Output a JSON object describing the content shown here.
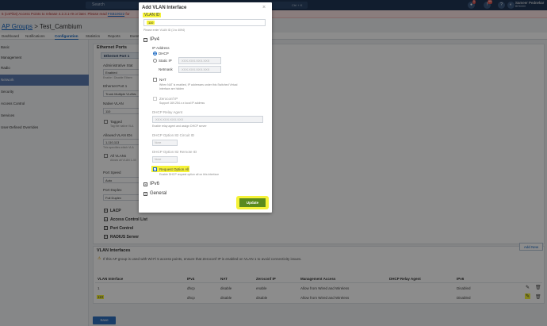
{
  "topbar": {
    "search_placeholder": "Search",
    "shortcut": "Ctrl + K",
    "notif_badge": "1",
    "alert_badge": "99",
    "user_name": "Sameer Pednekar",
    "user_role": "BRK000"
  },
  "banner": {
    "text": "5 (cnPilot) Access Points to release 4.2.3.1-r9 or later. Please read",
    "link": "FSB19022",
    "suffix": "for"
  },
  "breadcrumb": {
    "root": "AP Groups",
    "sep": ">",
    "current": "Test_Cambium"
  },
  "tabs": [
    "Dashboard",
    "Notifications",
    "Configuration",
    "Statistics",
    "Reports",
    "Events"
  ],
  "sidebar": [
    "Basic",
    "Management",
    "Radio",
    "Network",
    "Security",
    "Access Control",
    "Services",
    "User-Defined Overrides"
  ],
  "ethernet": {
    "section_title": "Ethernet Ports",
    "subtab": "Ethernet Port 1",
    "admin_label": "Administrative Stat",
    "admin_value": "Enabled",
    "admin_help": "Enable / Disable Ethern",
    "port1_label": "Ethernet Port 1",
    "port1_value": "Trunk Multiple VLANs",
    "native_label": "Native VLAN",
    "native_value": "110",
    "tagged_label": "Tagged",
    "tagged_help": "Tag the native VLA",
    "allowed_label": "Allowed VLAN IDs",
    "allowed_value": "1,110,113",
    "allowed_help": "This specifies which VLA",
    "allvlan_label": "All VLANs",
    "allvlan_help": "Allows all VLAN 1-40",
    "speed_label": "Port Speed",
    "speed_value": "Auto",
    "duplex_label": "Port Duplex",
    "duplex_value": "Full Duplex",
    "accordions": [
      "LACP",
      "Access Control List",
      "Port Control",
      "RADIUS Server"
    ]
  },
  "vlan": {
    "section_title": "VLAN Interfaces",
    "info": "If this AP group is used with Wi-Fi 5 access points, ensure that Zeroconf IP is enabled on VLAN 1 to avoid connectivity issues.",
    "add_label": "Add New",
    "headers": [
      "VLAN Interface",
      "IPv4",
      "NAT",
      "Zeroconf IP",
      "Management Access",
      "DHCP Relay Agent",
      "IPv6"
    ],
    "rows": [
      [
        "1",
        "dhcp",
        "disable",
        "enable",
        "Allow from Wired and Wireless",
        "",
        "Disabled"
      ],
      [
        "110",
        "dhcp",
        "disable",
        "disable",
        "Allow from Wired and Wireless",
        "",
        "Disabled"
      ]
    ]
  },
  "save_label": "Save",
  "modal": {
    "title": "Add VLAN Interface",
    "vlan_id_label": "VLAN ID",
    "vlan_id_value": "110",
    "vlan_id_help": "Please enter VLAN ID (1 to 4094)",
    "ipv4_label": "IPv4",
    "ip_address_label": "IP Address",
    "dhcp_label": "DHCP",
    "static_label": "Static IP",
    "ip_placeholder": "XXX.XXX.XXX.XXX",
    "netmask_label": "Netmask",
    "netmask_placeholder": "XXX.XXX.XXX.XXX",
    "nat_label": "NAT",
    "nat_help": "When NAT is enabled, IP addresses under this Switched Virtual",
    "nat_help2": "Interface are hidden",
    "zeroconf_label": "Zeroconf IP",
    "zeroconf_help": "Support 169.254.x.x local IP address",
    "relay_label": "DHCP Relay Agent",
    "relay_placeholder": "XXX.XXX.XXX.XXX",
    "relay_help": "Enable relay agent and assign DHCP server",
    "circuit_label": "DHCP Option 82 Circuit ID",
    "circuit_value": "None",
    "remote_label": "DHCP Option 82 Remote ID",
    "remote_value": "None",
    "request_label": "Request Option All",
    "request_help": "Enable DHCP request option all on this interface",
    "ipv6_label": "IPv6",
    "general_label": "General",
    "update_label": "Update"
  }
}
